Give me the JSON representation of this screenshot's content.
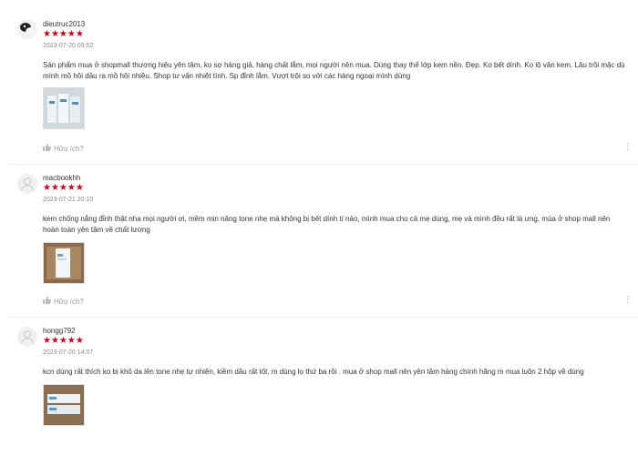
{
  "reviews": [
    {
      "username": "dieutruc2013",
      "stars": "★★★★★",
      "date": "2023-07-20 09:52",
      "text": "Sản phẩm mua ở shopmall thương hiệu yên tâm, ko sợ hàng giả, hàng chất lắm, mọi người nên mua. Dùng thay thế lớp kem nền. Đẹp. Ko bết dính. Ko lộ vân kem. Lâu trôi mặc dù mình mồ hôi dầu ra mồ hôi nhiều. Shop tư vấn nhiệt tình. Sp đỉnh lắm. Vượt trội so với các hàng ngoại mình dùng",
      "helpful": "Hữu ích?"
    },
    {
      "username": "macbookhh",
      "stars": "★★★★★",
      "date": "2023-07-21 20:10",
      "text": "kem chống nắng đỉnh thật nha mọi người ơi, mềm mịn nâng tone nhẹ mà không bị bết dính tí nào, mình mua cho cả mẹ dùng, mẹ và mình đều rất là ưng, mùa ở shop mall nên hoàn toàn yên tâm về chất lương",
      "helpful": "Hữu ích?"
    },
    {
      "username": "hongg792",
      "stars": "★★★★★",
      "date": "2023-07-20 14:07",
      "text": "kcn dùng rất thích ko bị khô da lên tone nhẹ tự nhiên, kiềm dầu rất tốt. m dùng lọ thứ ba rồi . mua ở shop mall nên yên tâm hàng chính hãng m mua luôn 2 hộp về dùng"
    }
  ],
  "icons": {
    "like": "thumbs-up-icon",
    "more": "more-vertical-icon",
    "avatar": "user-avatar-icon"
  }
}
